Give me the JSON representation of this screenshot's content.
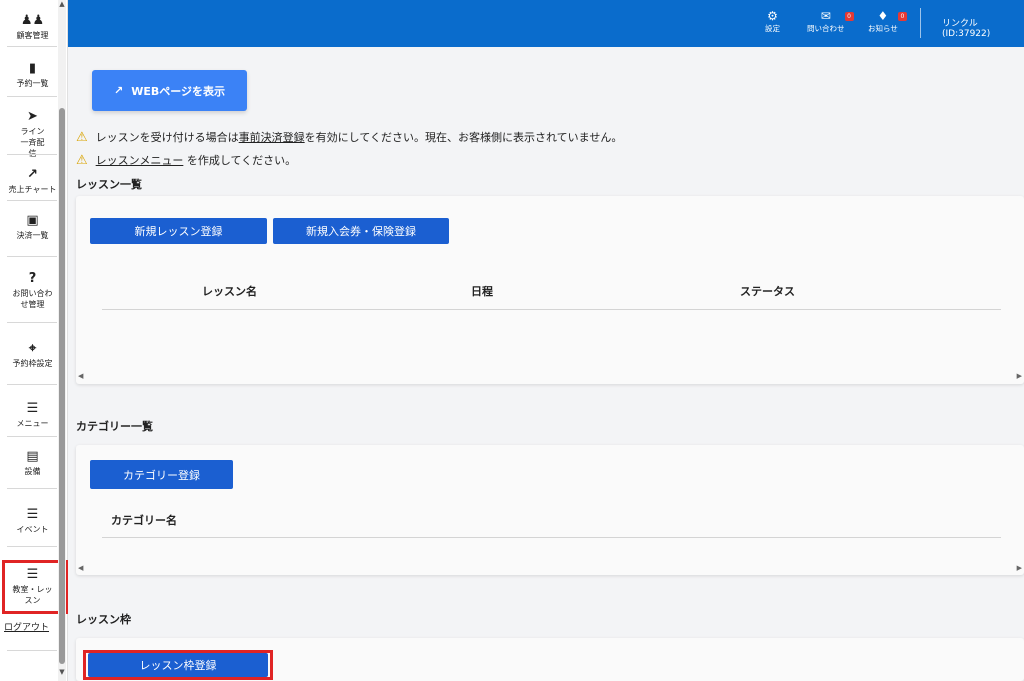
{
  "sidebar": {
    "items": [
      {
        "label": "顧客管理",
        "icon": "users-icon"
      },
      {
        "label": "予約一覧",
        "icon": "clipboard-icon"
      },
      {
        "label": "ライン一斉配信",
        "icon": "send-icon"
      },
      {
        "label": "売上チャート",
        "icon": "chart-icon"
      },
      {
        "label": "決済一覧",
        "icon": "money-icon"
      },
      {
        "label": "お問い合わせ管理",
        "icon": "question-icon"
      },
      {
        "label": "予約枠設定",
        "icon": "crop-icon"
      },
      {
        "label": "メニュー",
        "icon": "list-icon"
      },
      {
        "label": "設備",
        "icon": "car-icon"
      },
      {
        "label": "イベント",
        "icon": "list-icon"
      },
      {
        "label": "教室・レッスン",
        "icon": "list-icon"
      }
    ],
    "logout": "ログアウト"
  },
  "header": {
    "settings": "設定",
    "contact": "問い合わせ",
    "contact_badge": "0",
    "notice": "お知らせ",
    "notice_badge": "0",
    "user": "リンクル (ID:37922)"
  },
  "main": {
    "web_button": "WEBページを表示",
    "warning1": {
      "before": "レッスンを受け付ける場合は",
      "link": "事前決済登録",
      "after": "を有効にしてください。現在、お客様側に表示されていません。"
    },
    "warning2": {
      "link": "レッスンメニュー",
      "after": " を作成してください。"
    },
    "lessons": {
      "title": "レッスン一覧",
      "btn_new": "新規レッスン登録",
      "btn_membership": "新規入会券・保険登録",
      "columns": [
        "レッスン名",
        "日程",
        "ステータス"
      ]
    },
    "categories": {
      "title": "カテゴリー一覧",
      "btn_new": "カテゴリー登録",
      "columns": [
        "カテゴリー名"
      ]
    },
    "slots": {
      "title": "レッスン枠",
      "btn_new": "レッスン枠登録"
    }
  },
  "colors": {
    "header": "#0a6ccc",
    "primary_button": "#1b5fd1",
    "web_button": "#3b82f6",
    "highlight": "#e02424"
  }
}
